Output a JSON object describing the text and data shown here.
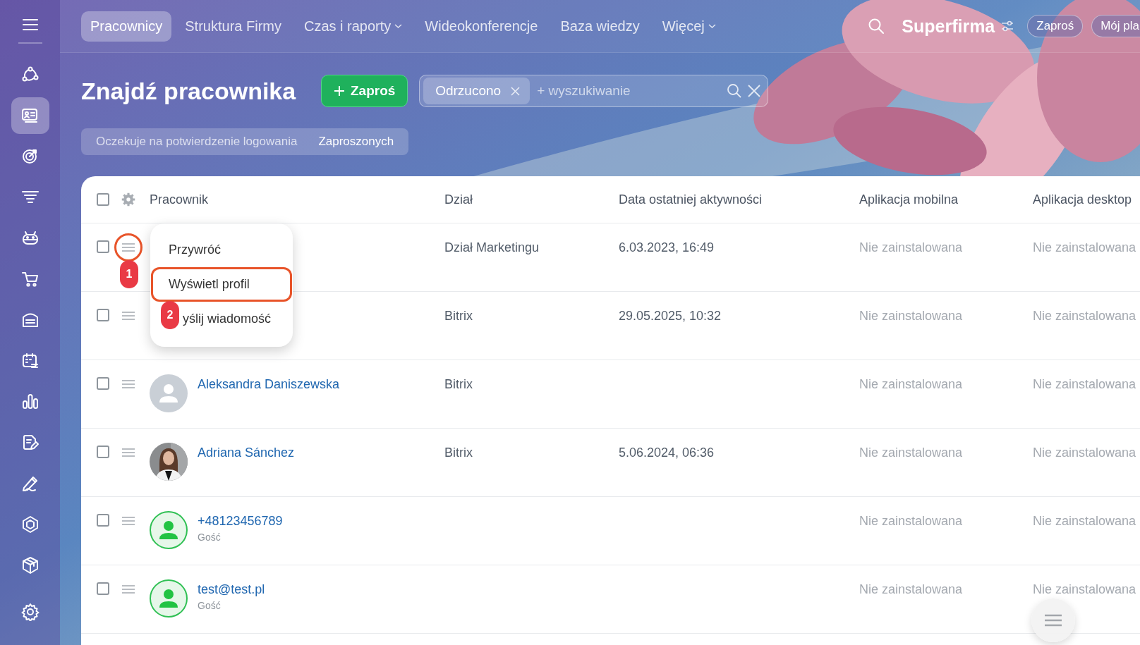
{
  "sidebar": {
    "items": [
      {
        "selected": false
      },
      {
        "selected": true
      },
      {
        "selected": false
      },
      {
        "selected": false
      },
      {
        "selected": false
      },
      {
        "selected": false
      },
      {
        "selected": false
      },
      {
        "selected": false
      },
      {
        "selected": false
      },
      {
        "selected": false
      },
      {
        "selected": false
      },
      {
        "selected": false
      },
      {
        "selected": false
      },
      {
        "selected": false
      }
    ]
  },
  "top_nav": {
    "tabs": [
      {
        "label": "Pracownicy",
        "selected": true,
        "has_menu": false
      },
      {
        "label": "Struktura Firmy",
        "selected": false,
        "has_menu": false
      },
      {
        "label": "Czas i raporty",
        "selected": false,
        "has_menu": true
      },
      {
        "label": "Wideokonferencje",
        "selected": false,
        "has_menu": false
      },
      {
        "label": "Baza wiedzy",
        "selected": false,
        "has_menu": false
      },
      {
        "label": "Więcej",
        "selected": false,
        "has_menu": true
      }
    ],
    "company": "Superfirma",
    "buttons": [
      "Zaproś",
      "Mój pla"
    ]
  },
  "header": {
    "title": "Znajdź pracownika",
    "invite_button": "Zaproś",
    "search": {
      "chips": [
        {
          "label": "Odrzucono"
        }
      ],
      "placeholder": "+ wyszukiwanie"
    },
    "filters": [
      {
        "label": "Oczekuje na potwierdzenie logowania",
        "selected": false
      },
      {
        "label": "Zaproszonych",
        "selected": true
      }
    ]
  },
  "table": {
    "select_all_checked": false,
    "columns": [
      "Pracownik",
      "Dział",
      "Data ostatniej aktywności",
      "Aplikacja mobilna",
      "Aplikacja desktop"
    ],
    "rows": [
      {
        "checked": false,
        "menu_marked": true,
        "department": "Dział Marketingu",
        "last_activity": "6.03.2023, 16:49",
        "mobile_app": "Nie zainstalowana",
        "desktop_app": "Nie zainstalowana"
      },
      {
        "checked": false,
        "menu_marked": false,
        "department": "Bitrix",
        "last_activity": "29.05.2025, 10:32",
        "mobile_app": "Nie zainstalowana",
        "desktop_app": "Nie zainstalowana"
      },
      {
        "checked": false,
        "menu_marked": false,
        "avatar": {
          "kind": "placeholder"
        },
        "name": "Aleksandra Daniszewska",
        "department": "Bitrix",
        "mobile_app": "Nie zainstalowana",
        "desktop_app": "Nie zainstalowana"
      },
      {
        "checked": false,
        "menu_marked": false,
        "name": "Adriana Sánchez",
        "department": "Bitrix",
        "last_activity": "5.06.2024, 06:36",
        "mobile_app": "Nie zainstalowana",
        "desktop_app": "Nie zainstalowana"
      },
      {
        "checked": false,
        "menu_marked": false,
        "avatar": {
          "kind": "guest"
        },
        "name": "+48123456789",
        "subtitle": "Gość",
        "mobile_app": "Nie zainstalowana",
        "desktop_app": "Nie zainstalowana"
      },
      {
        "checked": false,
        "menu_marked": false,
        "avatar": {
          "kind": "guest"
        },
        "name": "test@test.pl",
        "subtitle": "Gość",
        "mobile_app": "Nie zainstalowana",
        "desktop_app": "Nie zainstalowana"
      }
    ]
  },
  "row_menu": {
    "items": [
      {
        "label": "Przywróć",
        "highlighted": false
      },
      {
        "label": "Wyświetl profil",
        "highlighted": true
      },
      {
        "label": "yślij wiadomość",
        "highlighted": false
      }
    ]
  },
  "annotations": [
    {
      "label": "1"
    },
    {
      "label": "2"
    }
  ]
}
